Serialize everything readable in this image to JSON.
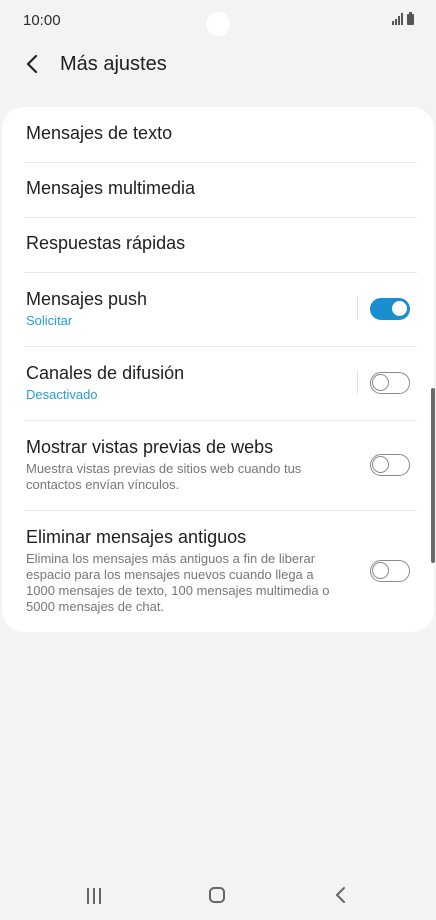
{
  "status_bar": {
    "time": "10:00"
  },
  "header": {
    "title": "Más ajustes"
  },
  "settings": [
    {
      "label": "Mensajes de texto"
    },
    {
      "label": "Mensajes multimedia"
    },
    {
      "label": "Respuestas rápidas"
    },
    {
      "label": "Mensajes push",
      "subtitle": "Solicitar",
      "toggle": true
    },
    {
      "label": "Canales de difusión",
      "subtitle": "Desactivado",
      "toggle": false
    },
    {
      "label": "Mostrar vistas previas de webs",
      "description": "Muestra vistas previas de sitios web cuando tus contactos envían vínculos.",
      "toggle": false
    },
    {
      "label": "Eliminar mensajes antiguos",
      "description": "Elimina los mensajes más antiguos a fin de liberar espacio para los mensajes nuevos cuando llega a 1000 mensajes de texto, 100 mensajes multimedia o 5000 mensajes de chat.",
      "toggle": false
    }
  ],
  "colors": {
    "accent": "#1a8fd0",
    "subtitle": "#24a0d8",
    "background": "#f3f3f3"
  }
}
